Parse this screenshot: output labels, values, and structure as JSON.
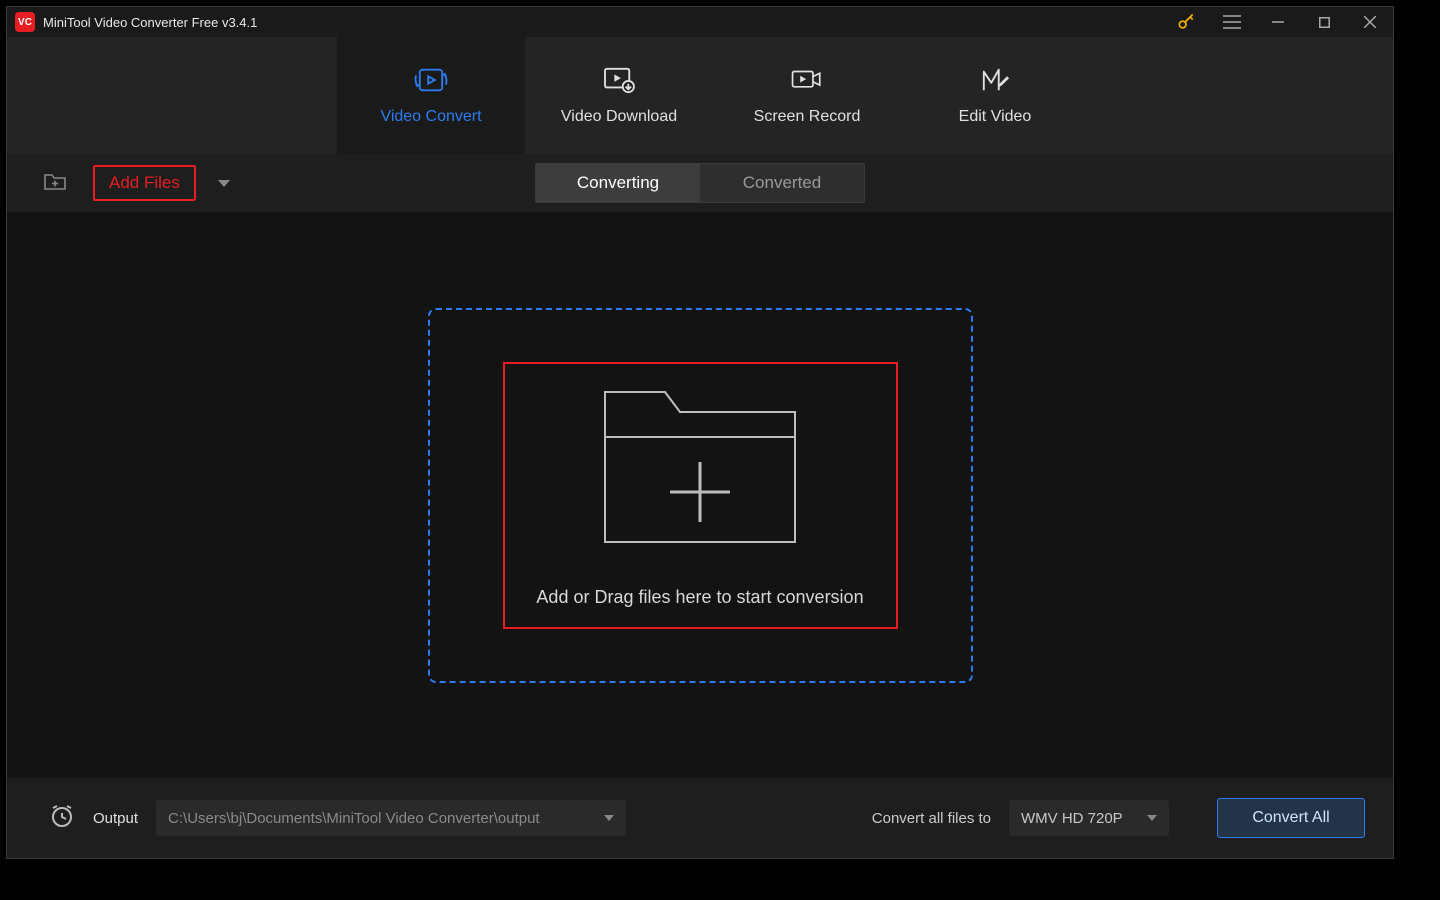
{
  "title": "MiniTool Video Converter Free v3.4.1",
  "app_icon_text": "VC",
  "main_tabs": {
    "video_convert": "Video Convert",
    "video_download": "Video Download",
    "screen_record": "Screen Record",
    "edit_video": "Edit Video"
  },
  "toolbar": {
    "add_files": "Add Files"
  },
  "segmented": {
    "converting": "Converting",
    "converted": "Converted"
  },
  "drop_text": "Add or Drag files here to start conversion",
  "footer": {
    "output_label": "Output",
    "output_path": "C:\\Users\\bj\\Documents\\MiniTool Video Converter\\output",
    "convert_all_label": "Convert all files to",
    "format_selected": "WMV HD 720P",
    "convert_all_button": "Convert All"
  }
}
